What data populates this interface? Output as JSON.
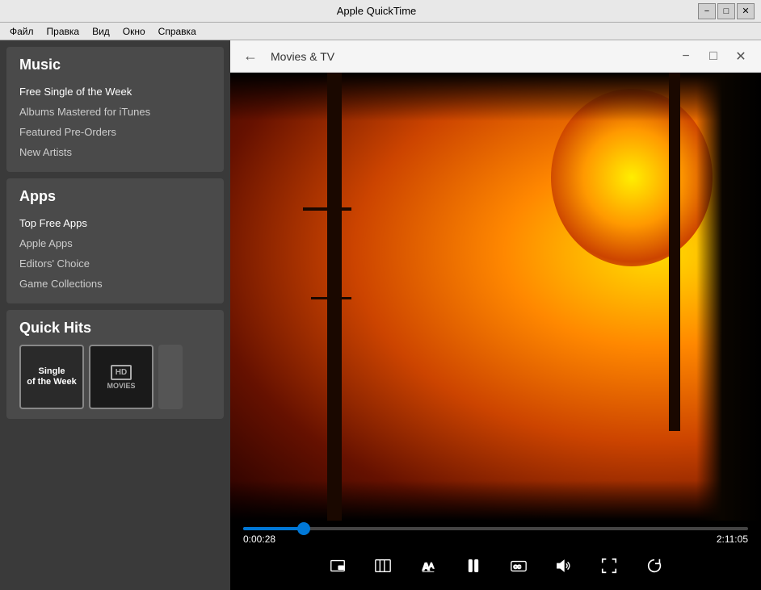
{
  "app": {
    "title": "Apple QuickTime",
    "minimize_label": "−",
    "maximize_label": "□",
    "close_label": "✕"
  },
  "menu": {
    "items": [
      "Файл",
      "Правка",
      "Вид",
      "Окно",
      "Справка"
    ]
  },
  "sidebar": {
    "music_section": {
      "title": "Music",
      "links": [
        "Free Single of the Week",
        "Albums Mastered for iTunes",
        "Featured Pre-Orders",
        "New Artists"
      ]
    },
    "apps_section": {
      "title": "Apps",
      "links": [
        "Top Free Apps",
        "Apple Apps",
        "Editors' Choice",
        "Game Collections"
      ]
    },
    "quick_hits": {
      "title": "Quick Hits",
      "item1_text": "Single\nof the Week",
      "item2_badge": "HD",
      "item2_text": "MOVIES"
    }
  },
  "movies_window": {
    "title": "Movies & TV",
    "back_icon": "←",
    "minimize_label": "−",
    "maximize_label": "□",
    "close_label": "✕",
    "time_current": "0:00:28",
    "time_total": "2:11:05",
    "progress_percent": 12
  }
}
